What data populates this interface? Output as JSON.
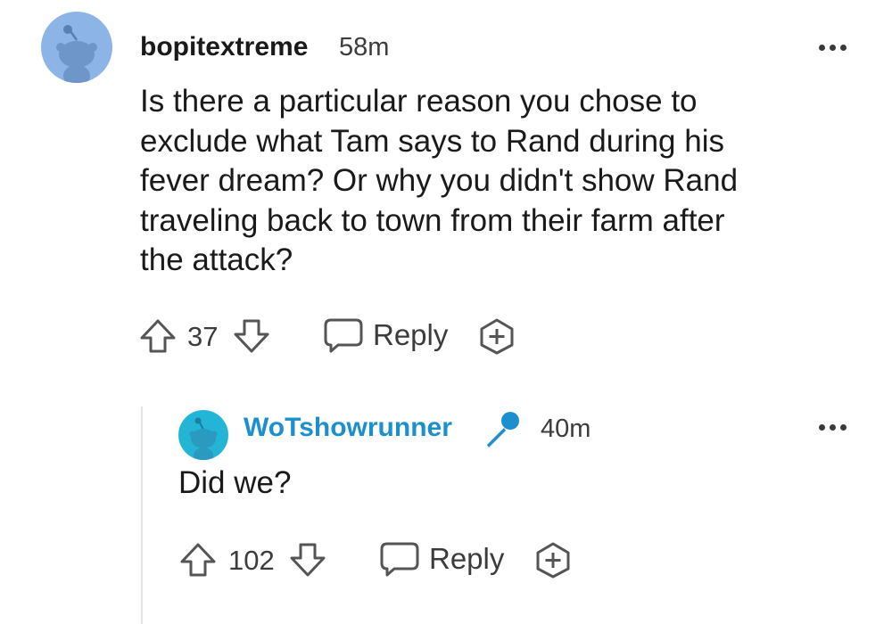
{
  "parent_comment": {
    "username": "bopitextreme",
    "time": "58m",
    "avatar_color": "#8cb4e6",
    "body": "Is there a particular reason you chose to\nexclude what Tam says to Rand during his\nfever dream? Or why you didn't show Rand\ntraveling back to town from their farm after\nthe attack?",
    "votes": "37",
    "reply_label": "Reply",
    "more_icon": "more-options-icon",
    "award_icon": "add-award-icon"
  },
  "reply_comment": {
    "username": "WoTshowrunner",
    "username_color": "#1c8fcf",
    "badge_icon": "microphone-icon",
    "time": "40m",
    "avatar_color": "#24b5d6",
    "body": "Did we?",
    "votes": "102",
    "reply_label": "Reply",
    "more_icon": "more-options-icon",
    "award_icon": "add-award-icon"
  }
}
